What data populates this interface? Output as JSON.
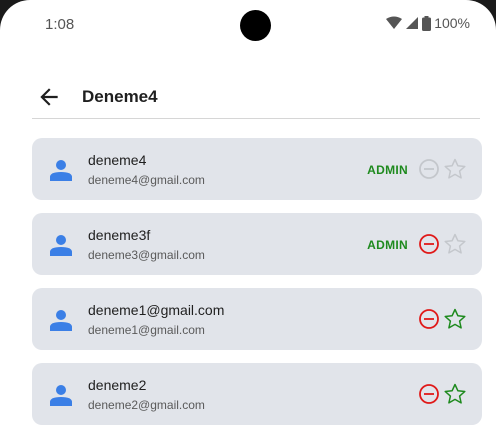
{
  "status_bar": {
    "time": "1:08",
    "battery": "100%"
  },
  "app_bar": {
    "title": "Deneme4",
    "back_icon": "arrow-left-icon"
  },
  "users": [
    {
      "name": "deneme4",
      "email": "deneme4@gmail.com",
      "badge": "ADMIN",
      "remove_enabled": false,
      "star_enabled": false
    },
    {
      "name": "deneme3f",
      "email": "deneme3@gmail.com",
      "badge": "ADMIN",
      "remove_enabled": true,
      "star_enabled": false
    },
    {
      "name": "deneme1@gmail.com",
      "email": "deneme1@gmail.com",
      "badge": "",
      "remove_enabled": true,
      "star_enabled": true
    },
    {
      "name": "deneme2",
      "email": "deneme2@gmail.com",
      "badge": "",
      "remove_enabled": true,
      "star_enabled": true
    }
  ],
  "colors": {
    "card_bg": "#e1e4ea",
    "avatar": "#3b7fe6",
    "admin": "#1e8a1e",
    "remove_active": "#e01919",
    "star_active": "#1e8a1e",
    "disabled": "#c4c7cc"
  }
}
